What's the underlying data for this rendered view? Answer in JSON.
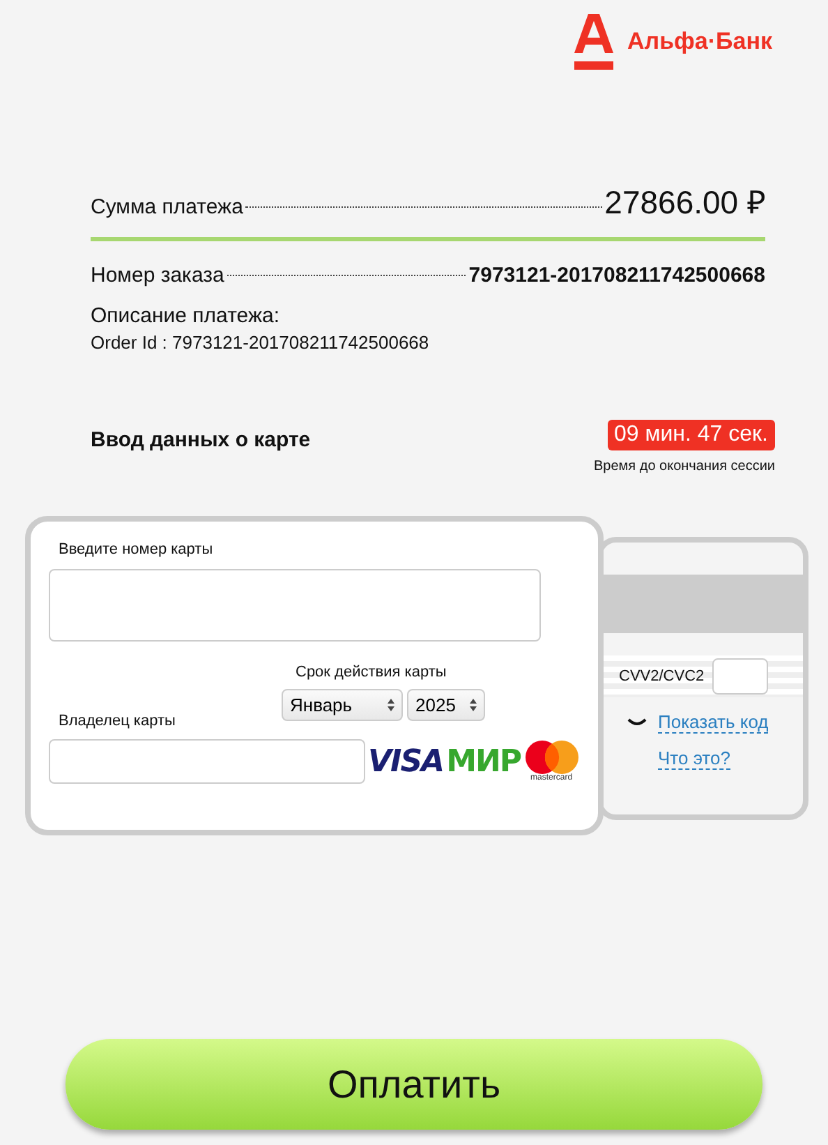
{
  "bank_logo": {
    "name": "Альфа·Банк"
  },
  "amount": {
    "label": "Сумма платежа",
    "value": "27866.00",
    "currency": "₽"
  },
  "order": {
    "label": "Номер заказа",
    "value": "7973121-201708211742500668"
  },
  "description": {
    "label": "Описание платежа:",
    "text": "Order Id : 7973121-201708211742500668"
  },
  "card_section": {
    "title": "Ввод данных о карте",
    "timer": "09 мин. 47 сек.",
    "timer_caption": "Время до окончания сессии"
  },
  "card_form": {
    "number_label": "Введите номер карты",
    "expiry_label": "Срок действия карты",
    "month": "Январь",
    "year": "2025",
    "holder_label": "Владелец карты",
    "brands": [
      {
        "kind": "visa",
        "text": "VISA"
      },
      {
        "kind": "mir",
        "text": "МИР"
      },
      {
        "kind": "mastercard",
        "text": "mastercard"
      }
    ]
  },
  "card_back": {
    "cvv_label": "CVV2/CVC2",
    "show_code": "Показать код",
    "what_is_it": "Что это?"
  },
  "pay_button": "Оплатить"
}
